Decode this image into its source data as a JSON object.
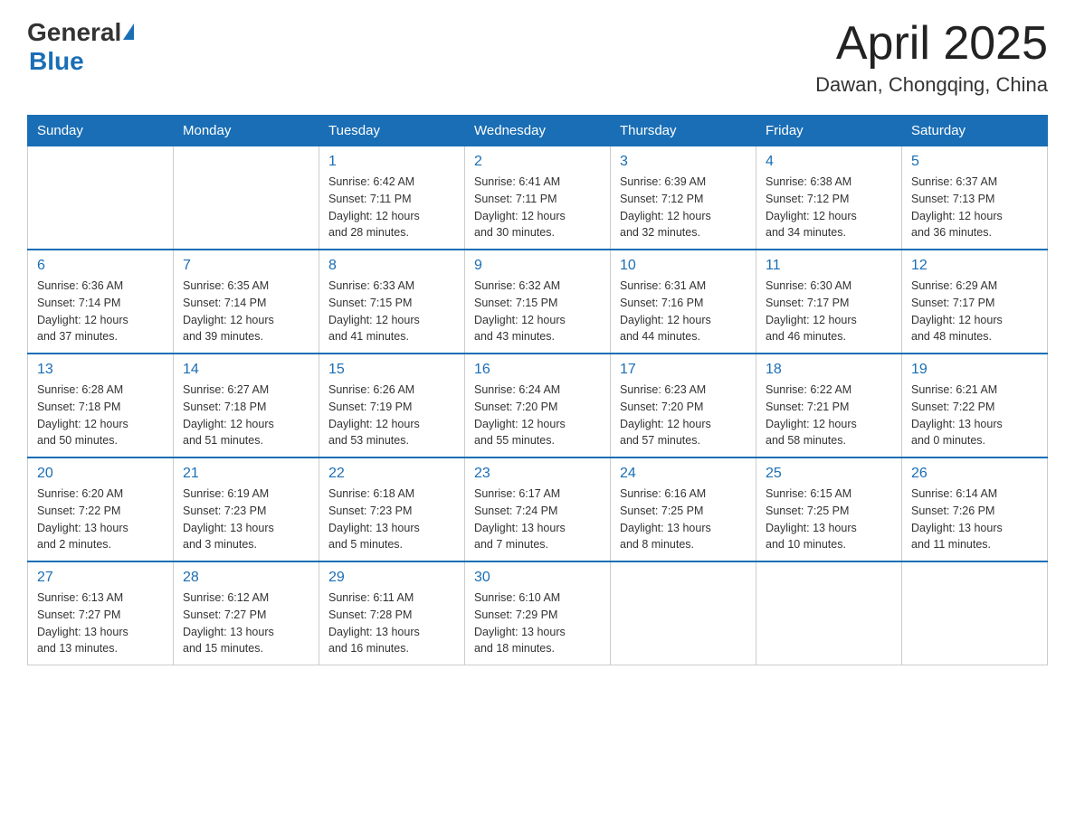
{
  "header": {
    "logo_general": "General",
    "logo_blue": "Blue",
    "title": "April 2025",
    "location": "Dawan, Chongqing, China"
  },
  "weekdays": [
    "Sunday",
    "Monday",
    "Tuesday",
    "Wednesday",
    "Thursday",
    "Friday",
    "Saturday"
  ],
  "weeks": [
    [
      {
        "day": "",
        "info": ""
      },
      {
        "day": "",
        "info": ""
      },
      {
        "day": "1",
        "info": "Sunrise: 6:42 AM\nSunset: 7:11 PM\nDaylight: 12 hours\nand 28 minutes."
      },
      {
        "day": "2",
        "info": "Sunrise: 6:41 AM\nSunset: 7:11 PM\nDaylight: 12 hours\nand 30 minutes."
      },
      {
        "day": "3",
        "info": "Sunrise: 6:39 AM\nSunset: 7:12 PM\nDaylight: 12 hours\nand 32 minutes."
      },
      {
        "day": "4",
        "info": "Sunrise: 6:38 AM\nSunset: 7:12 PM\nDaylight: 12 hours\nand 34 minutes."
      },
      {
        "day": "5",
        "info": "Sunrise: 6:37 AM\nSunset: 7:13 PM\nDaylight: 12 hours\nand 36 minutes."
      }
    ],
    [
      {
        "day": "6",
        "info": "Sunrise: 6:36 AM\nSunset: 7:14 PM\nDaylight: 12 hours\nand 37 minutes."
      },
      {
        "day": "7",
        "info": "Sunrise: 6:35 AM\nSunset: 7:14 PM\nDaylight: 12 hours\nand 39 minutes."
      },
      {
        "day": "8",
        "info": "Sunrise: 6:33 AM\nSunset: 7:15 PM\nDaylight: 12 hours\nand 41 minutes."
      },
      {
        "day": "9",
        "info": "Sunrise: 6:32 AM\nSunset: 7:15 PM\nDaylight: 12 hours\nand 43 minutes."
      },
      {
        "day": "10",
        "info": "Sunrise: 6:31 AM\nSunset: 7:16 PM\nDaylight: 12 hours\nand 44 minutes."
      },
      {
        "day": "11",
        "info": "Sunrise: 6:30 AM\nSunset: 7:17 PM\nDaylight: 12 hours\nand 46 minutes."
      },
      {
        "day": "12",
        "info": "Sunrise: 6:29 AM\nSunset: 7:17 PM\nDaylight: 12 hours\nand 48 minutes."
      }
    ],
    [
      {
        "day": "13",
        "info": "Sunrise: 6:28 AM\nSunset: 7:18 PM\nDaylight: 12 hours\nand 50 minutes."
      },
      {
        "day": "14",
        "info": "Sunrise: 6:27 AM\nSunset: 7:18 PM\nDaylight: 12 hours\nand 51 minutes."
      },
      {
        "day": "15",
        "info": "Sunrise: 6:26 AM\nSunset: 7:19 PM\nDaylight: 12 hours\nand 53 minutes."
      },
      {
        "day": "16",
        "info": "Sunrise: 6:24 AM\nSunset: 7:20 PM\nDaylight: 12 hours\nand 55 minutes."
      },
      {
        "day": "17",
        "info": "Sunrise: 6:23 AM\nSunset: 7:20 PM\nDaylight: 12 hours\nand 57 minutes."
      },
      {
        "day": "18",
        "info": "Sunrise: 6:22 AM\nSunset: 7:21 PM\nDaylight: 12 hours\nand 58 minutes."
      },
      {
        "day": "19",
        "info": "Sunrise: 6:21 AM\nSunset: 7:22 PM\nDaylight: 13 hours\nand 0 minutes."
      }
    ],
    [
      {
        "day": "20",
        "info": "Sunrise: 6:20 AM\nSunset: 7:22 PM\nDaylight: 13 hours\nand 2 minutes."
      },
      {
        "day": "21",
        "info": "Sunrise: 6:19 AM\nSunset: 7:23 PM\nDaylight: 13 hours\nand 3 minutes."
      },
      {
        "day": "22",
        "info": "Sunrise: 6:18 AM\nSunset: 7:23 PM\nDaylight: 13 hours\nand 5 minutes."
      },
      {
        "day": "23",
        "info": "Sunrise: 6:17 AM\nSunset: 7:24 PM\nDaylight: 13 hours\nand 7 minutes."
      },
      {
        "day": "24",
        "info": "Sunrise: 6:16 AM\nSunset: 7:25 PM\nDaylight: 13 hours\nand 8 minutes."
      },
      {
        "day": "25",
        "info": "Sunrise: 6:15 AM\nSunset: 7:25 PM\nDaylight: 13 hours\nand 10 minutes."
      },
      {
        "day": "26",
        "info": "Sunrise: 6:14 AM\nSunset: 7:26 PM\nDaylight: 13 hours\nand 11 minutes."
      }
    ],
    [
      {
        "day": "27",
        "info": "Sunrise: 6:13 AM\nSunset: 7:27 PM\nDaylight: 13 hours\nand 13 minutes."
      },
      {
        "day": "28",
        "info": "Sunrise: 6:12 AM\nSunset: 7:27 PM\nDaylight: 13 hours\nand 15 minutes."
      },
      {
        "day": "29",
        "info": "Sunrise: 6:11 AM\nSunset: 7:28 PM\nDaylight: 13 hours\nand 16 minutes."
      },
      {
        "day": "30",
        "info": "Sunrise: 6:10 AM\nSunset: 7:29 PM\nDaylight: 13 hours\nand 18 minutes."
      },
      {
        "day": "",
        "info": ""
      },
      {
        "day": "",
        "info": ""
      },
      {
        "day": "",
        "info": ""
      }
    ]
  ]
}
